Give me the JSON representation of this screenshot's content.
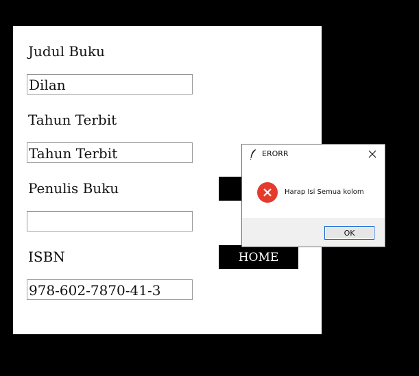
{
  "form": {
    "judul_label": "Judul Buku",
    "judul_value": "Dilan",
    "tahun_label": "Tahun Terbit",
    "tahun_value": "Tahun Terbit",
    "penulis_label": "Penulis Buku",
    "penulis_value": "",
    "isbn_label": "ISBN",
    "isbn_value": "978-602-7870-41-3",
    "home_label": "HOME"
  },
  "dialog": {
    "title": "ERORR",
    "message": "Harap Isi Semua kolom",
    "ok_label": "OK",
    "icon": "error-icon"
  }
}
